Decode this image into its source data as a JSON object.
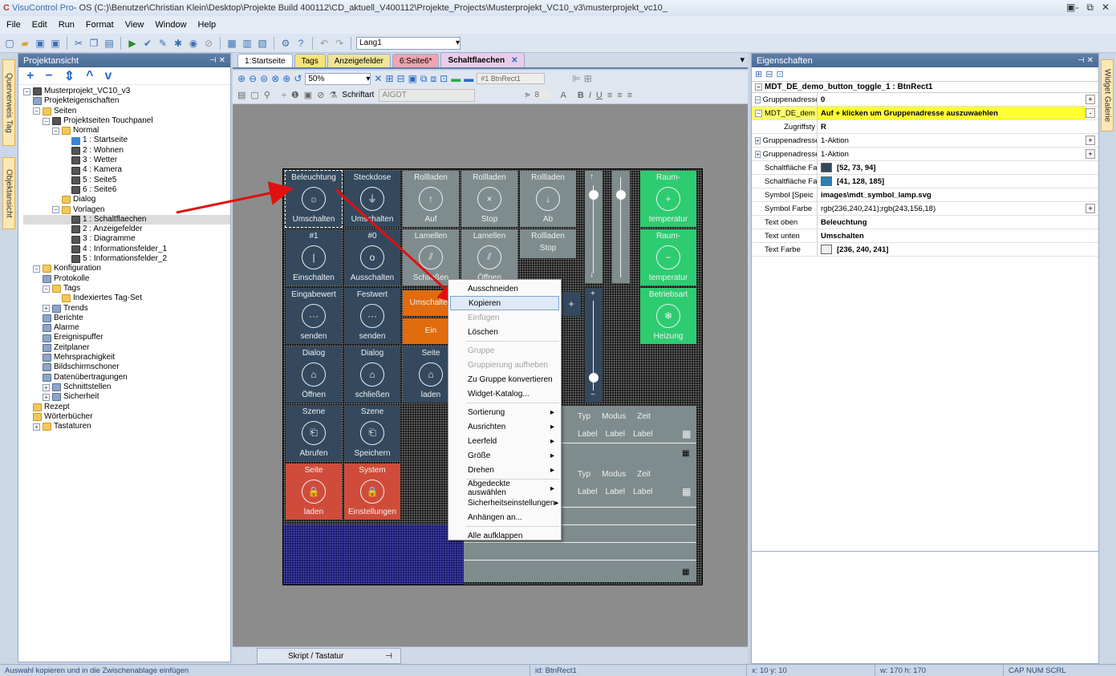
{
  "window": {
    "app_name": "VisuControl Pro",
    "title_rest": " - OS (C:)\\Benutzer\\Christian Klein\\Desktop\\Projekte Build 400112\\CD_aktuell_V400112\\Projekte_Projects\\Musterprojekt_VC10_v3\\musterprojekt_vc10_",
    "logo": "C"
  },
  "menu": [
    "File",
    "Edit",
    "Run",
    "Format",
    "View",
    "Window",
    "Help"
  ],
  "toolbar": {
    "language_value": "Lang1"
  },
  "side_tabs": {
    "left1": "Querverweis Tag",
    "left2": "Objektansicht",
    "right1": "Widget Galerie"
  },
  "project_panel": {
    "title": "Projektansicht",
    "tools": [
      "+",
      "−",
      "⇕",
      "^",
      "v"
    ],
    "tree": [
      {
        "label": "Musterprojekt_VC10_v3",
        "indent": 0,
        "icon": "page",
        "exp": "−"
      },
      {
        "label": "Projekteigenschaften",
        "indent": 1,
        "icon": "gear"
      },
      {
        "label": "Seiten",
        "indent": 1,
        "icon": "folder",
        "exp": "−"
      },
      {
        "label": "Projektseiten Touchpanel",
        "indent": 2,
        "icon": "page",
        "exp": "−"
      },
      {
        "label": "Normal",
        "indent": 3,
        "icon": "folder",
        "exp": "−"
      },
      {
        "label": "1 : Startseite",
        "indent": 5,
        "icon": "home"
      },
      {
        "label": "2 : Wohnen",
        "indent": 5,
        "icon": "page"
      },
      {
        "label": "3 : Wetter",
        "indent": 5,
        "icon": "page"
      },
      {
        "label": "4 : Kamera",
        "indent": 5,
        "icon": "page"
      },
      {
        "label": "5 : Seite5",
        "indent": 5,
        "icon": "page"
      },
      {
        "label": "6 : Seite6",
        "indent": 5,
        "icon": "page"
      },
      {
        "label": "Dialog",
        "indent": 4,
        "icon": "folder"
      },
      {
        "label": "Vorlagen",
        "indent": 3,
        "icon": "folder",
        "exp": "−"
      },
      {
        "label": "1 : Schaltflaechen",
        "indent": 5,
        "icon": "page",
        "selected": true
      },
      {
        "label": "2 : Anzeigefelder",
        "indent": 5,
        "icon": "page"
      },
      {
        "label": "3 : Diagramme",
        "indent": 5,
        "icon": "page"
      },
      {
        "label": "4 : Informationsfelder_1",
        "indent": 5,
        "icon": "page"
      },
      {
        "label": "5 : Informationsfelder_2",
        "indent": 5,
        "icon": "page"
      },
      {
        "label": "Konfiguration",
        "indent": 1,
        "icon": "folder",
        "exp": "−"
      },
      {
        "label": "Protokolle",
        "indent": 2,
        "icon": "gear"
      },
      {
        "label": "Tags",
        "indent": 2,
        "icon": "folder",
        "exp": "−"
      },
      {
        "label": "Indexiertes Tag-Set",
        "indent": 4,
        "icon": "folder"
      },
      {
        "label": "Trends",
        "indent": 2,
        "icon": "gear",
        "exp": "+"
      },
      {
        "label": "Berichte",
        "indent": 2,
        "icon": "gear"
      },
      {
        "label": "Alarme",
        "indent": 2,
        "icon": "gear"
      },
      {
        "label": "Ereignispuffer",
        "indent": 2,
        "icon": "gear"
      },
      {
        "label": "Zeitplaner",
        "indent": 2,
        "icon": "gear"
      },
      {
        "label": "Mehrsprachigkeit",
        "indent": 2,
        "icon": "gear"
      },
      {
        "label": "Bildschirmschoner",
        "indent": 2,
        "icon": "gear"
      },
      {
        "label": "Datenübertragungen",
        "indent": 2,
        "icon": "gear"
      },
      {
        "label": "Schnittstellen",
        "indent": 2,
        "icon": "gear",
        "exp": "+"
      },
      {
        "label": "Sicherheit",
        "indent": 2,
        "icon": "gear",
        "exp": "+"
      },
      {
        "label": "Rezept",
        "indent": 1,
        "icon": "folder"
      },
      {
        "label": "Wörterbücher",
        "indent": 1,
        "icon": "folder"
      },
      {
        "label": "Tastaturen",
        "indent": 1,
        "icon": "folder",
        "exp": "+"
      }
    ]
  },
  "doc_tabs": [
    {
      "label": "1:Startseite",
      "color": "#ffffff"
    },
    {
      "label": "Tags",
      "color": "#f7e37a"
    },
    {
      "label": "Anzeigefelder",
      "color": "#f0e39a"
    },
    {
      "label": "6:Seite6*",
      "color": "#f0a3b0"
    },
    {
      "label": "Schaltflaechen",
      "color": "#e8cdea",
      "active": true
    }
  ],
  "editor": {
    "zoom": "50%",
    "object_name": "#1 BtnRect1",
    "font_label": "Schriftart",
    "font_value": "AIGDT",
    "font_size": "8"
  },
  "widgets": {
    "row1": [
      {
        "top": "Beleuchtung",
        "bottom": "Umschalten",
        "icon": "☼",
        "color": "dark"
      },
      {
        "top": "Steckdose",
        "bottom": "Umschalten",
        "icon": "⏚",
        "color": "dark"
      },
      {
        "top": "Rollladen",
        "bottom": "Auf",
        "icon": "↑",
        "color": "gray"
      },
      {
        "top": "Rollladen",
        "bottom": "Stop",
        "icon": "×",
        "color": "gray"
      },
      {
        "top": "Rollladen",
        "bottom": "Ab",
        "icon": "↓",
        "color": "gray"
      }
    ],
    "raum1": {
      "top": "Raum-",
      "bottom": "temperatur",
      "icon": "+"
    },
    "row2": [
      {
        "top": "#1",
        "bottom": "Einschalten",
        "icon": "|",
        "color": "dark"
      },
      {
        "top": "#0",
        "bottom": "Ausschalten",
        "icon": "o",
        "color": "dark"
      },
      {
        "top": "Lamellen",
        "bottom": "Schließen",
        "icon": "⫽",
        "color": "gray"
      },
      {
        "top": "Lamellen",
        "bottom": "Öffnen",
        "icon": "⫽",
        "color": "gray"
      }
    ],
    "rollstop": {
      "top": "Rollladen",
      "bottom": "Stop"
    },
    "raum2": {
      "top": "Raum-",
      "bottom": "temperatur",
      "icon": "−"
    },
    "row3": [
      {
        "top": "Eingabewert",
        "bottom": "senden",
        "icon": "···",
        "color": "dark"
      },
      {
        "top": "Festwert",
        "bottom": "senden",
        "icon": "···",
        "color": "dark"
      }
    ],
    "umschalten_orange": "Umschalten",
    "ein_orange": "Ein",
    "betrieb": {
      "top": "Betriebsart",
      "bottom": "Heizung",
      "icon": "❄"
    },
    "row4": [
      {
        "top": "Dialog",
        "bottom": "Öffnen",
        "icon": "⌂",
        "color": "dark"
      },
      {
        "top": "Dialog",
        "bottom": "schließen",
        "icon": "⌂",
        "color": "dark"
      },
      {
        "top": "Seite",
        "bottom": "laden",
        "icon": "⌂",
        "color": "dark"
      }
    ],
    "row5": [
      {
        "top": "Szene",
        "bottom": "Abrufen",
        "icon": "⎗",
        "color": "dark"
      },
      {
        "top": "Szene",
        "bottom": "Speichern",
        "icon": "⎗",
        "color": "dark"
      }
    ],
    "row6": [
      {
        "top": "Seite",
        "bottom": "laden",
        "icon": "🔒",
        "color": "red"
      },
      {
        "top": "System",
        "bottom": "Einstellungen",
        "icon": "🔒",
        "color": "red"
      }
    ],
    "info_headers": [
      "Typ",
      "Modus",
      "Zeit"
    ],
    "info_labels": [
      "Label",
      "Label",
      "Label"
    ]
  },
  "context_menu": [
    {
      "label": "Ausschneiden"
    },
    {
      "label": "Kopieren",
      "hl": true
    },
    {
      "label": "Einfügen",
      "dis": true
    },
    {
      "label": "Löschen"
    },
    {
      "sep": true
    },
    {
      "label": "Gruppe",
      "dis": true
    },
    {
      "label": "Gruppierung aufheben",
      "dis": true
    },
    {
      "label": "Zu Gruppe konvertieren"
    },
    {
      "label": "Widget-Katalog..."
    },
    {
      "sep": true
    },
    {
      "label": "Sortierung",
      "sub": true
    },
    {
      "label": "Ausrichten",
      "sub": true
    },
    {
      "label": "Leerfeld",
      "sub": true
    },
    {
      "label": "Größe",
      "sub": true
    },
    {
      "label": "Drehen",
      "sub": true
    },
    {
      "sep": true
    },
    {
      "label": "Abgedeckte auswählen",
      "sub": true
    },
    {
      "label": "Sicherheitseinstellungen",
      "sub": true
    },
    {
      "label": "Anhängen an..."
    },
    {
      "sep": true
    },
    {
      "label": "Alle aufklappen"
    }
  ],
  "properties": {
    "title": "Eigenschaften",
    "object": "MDT_DE_demo_button_toggle_1 : BtnRect1",
    "rows": [
      {
        "name": "Gruppenadresse",
        "value": "0",
        "bold": true,
        "exp": "−",
        "btn": "+"
      },
      {
        "name": "MDT_DE_dem",
        "value": "Auf + klicken um Gruppenadresse auszuwaehlen",
        "bold": true,
        "exp": "−",
        "yellow": true,
        "btn": "-"
      },
      {
        "name": "Zugriffsty",
        "value": "R",
        "bold": true,
        "indent": true
      },
      {
        "name": "Gruppenadresse",
        "value": "1-Aktion",
        "exp": "+",
        "btn": "+"
      },
      {
        "name": "Gruppenadresse",
        "value": "1-Aktion",
        "exp": "+",
        "btn": "+"
      },
      {
        "name": "Schaltfläche Farb",
        "value": "[52, 73, 94]",
        "bold": true,
        "swatch": "#34495e"
      },
      {
        "name": "Schaltfläche Farb",
        "value": "[41, 128, 185]",
        "bold": true,
        "swatch": "#2980b9"
      },
      {
        "name": "Symbol    [Speic",
        "value": "images\\mdt_symbol_lamp.svg",
        "bold": true
      },
      {
        "name": "Symbol Farbe",
        "value": "rgb(236,240,241);rgb(243,156,18)",
        "btn": "+"
      },
      {
        "name": "Text oben",
        "value": "Beleuchtung",
        "bold": true
      },
      {
        "name": "Text unten",
        "value": "Umschalten",
        "bold": true
      },
      {
        "name": "Text Farbe",
        "value": "[236, 240, 241]",
        "bold": true,
        "swatch": "#ecf0f1"
      }
    ]
  },
  "script_tab": "Skript / Tastatur",
  "status": {
    "message": "Auswahl kopieren und in die Zwischenablage einfügen",
    "id": "id:  BtnRect1",
    "pos": "x: 10    y: 10",
    "size": "w: 170    h: 170",
    "keys": "CAP  NUM  SCRL"
  }
}
